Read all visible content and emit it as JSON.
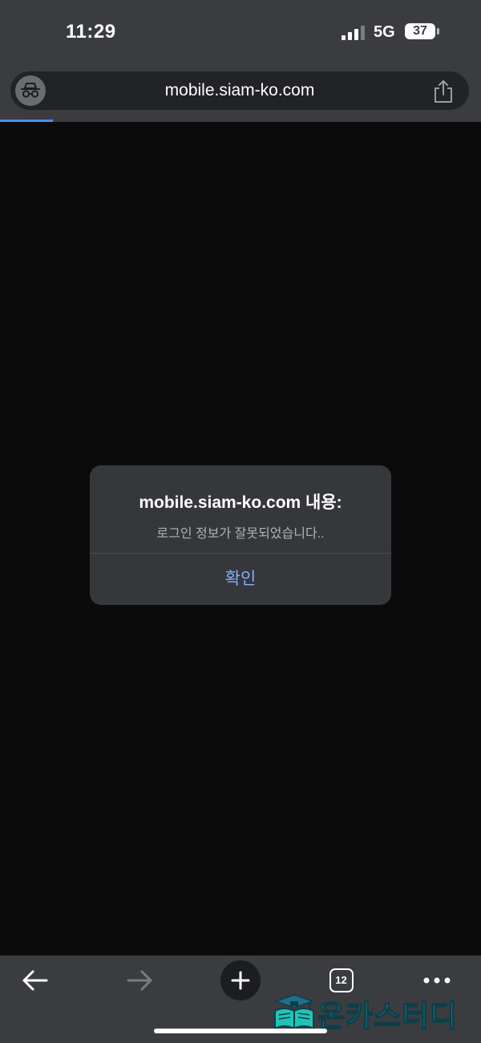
{
  "status_bar": {
    "time": "11:29",
    "network": "5G",
    "battery": "37",
    "signal_icon": "signal-bars-icon"
  },
  "browser": {
    "url": "mobile.siam-ko.com",
    "incognito_icon": "incognito-icon",
    "share_icon": "share-icon",
    "loading_progress": 0.11,
    "accent_color": "#4e8cf0"
  },
  "dialog": {
    "title": "mobile.siam-ko.com 내용:",
    "message": "로그인 정보가 잘못되었습니다..",
    "ok_label": "확인",
    "ok_color": "#7fb0ff"
  },
  "toolbar": {
    "back_icon": "back-arrow-icon",
    "forward_icon": "forward-arrow-icon",
    "new_tab_icon": "plus-icon",
    "tab_count": "12",
    "more_icon": "more-icon"
  },
  "watermark": {
    "text": "온카스터디",
    "color": "#22c3b6"
  }
}
